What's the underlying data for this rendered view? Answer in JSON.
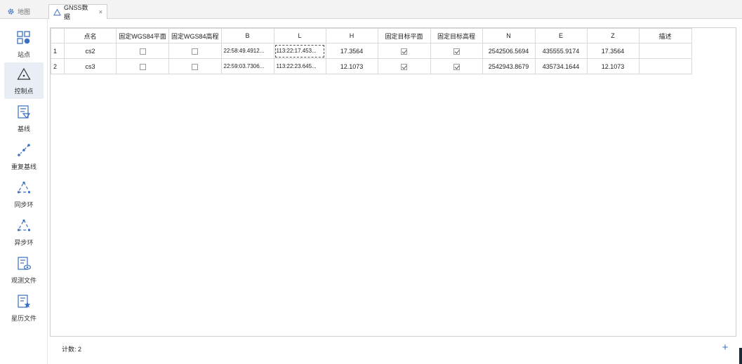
{
  "tabs": [
    {
      "label": "地图",
      "icon": "gear-icon",
      "active": false
    },
    {
      "label": "GNSS数据",
      "icon": "triangle-icon",
      "active": true,
      "close": "×"
    }
  ],
  "sidebar": {
    "items": [
      {
        "label": "站点",
        "icon": "station-grid-icon",
        "active": false
      },
      {
        "label": "控制点",
        "icon": "control-point-triangle-icon",
        "active": true
      },
      {
        "label": "基线",
        "icon": "baseline-icon",
        "active": false
      },
      {
        "label": "重复基线",
        "icon": "repeat-baseline-icon",
        "active": false
      },
      {
        "label": "同步环",
        "icon": "sync-loop-icon",
        "active": false
      },
      {
        "label": "异步环",
        "icon": "async-loop-icon",
        "active": false
      },
      {
        "label": "观测文件",
        "icon": "observation-file-icon",
        "active": false
      },
      {
        "label": "星历文件",
        "icon": "ephemeris-file-icon",
        "active": false
      }
    ]
  },
  "table": {
    "columns": [
      "",
      "点名",
      "固定WGS84平面",
      "固定WGS84高程",
      "B",
      "L",
      "H",
      "固定目标平面",
      "固定目标高程",
      "N",
      "E",
      "Z",
      "描述"
    ],
    "rows": [
      {
        "index": "1",
        "name": "cs2",
        "fix_wgs_plane": false,
        "fix_wgs_height": false,
        "B": "22:58:49.4912...",
        "L": "113:22:17.453...",
        "H": "17.3564",
        "fix_target_plane": true,
        "fix_target_height": true,
        "N": "2542506.5694",
        "E": "435555.9174",
        "Z": "17.3564",
        "desc": ""
      },
      {
        "index": "2",
        "name": "cs3",
        "fix_wgs_plane": false,
        "fix_wgs_height": false,
        "B": "22:59:03.7306...",
        "L": "113:22:23.645...",
        "H": "12.1073",
        "fix_target_plane": true,
        "fix_target_height": true,
        "N": "2542943.8679",
        "E": "435734.1644",
        "Z": "12.1073",
        "desc": ""
      }
    ]
  },
  "footer": {
    "count_label": "计数: 2",
    "add_label": "+"
  },
  "colors": {
    "accent": "#3a6fc1",
    "sidebar_active": "#e9edf5"
  }
}
